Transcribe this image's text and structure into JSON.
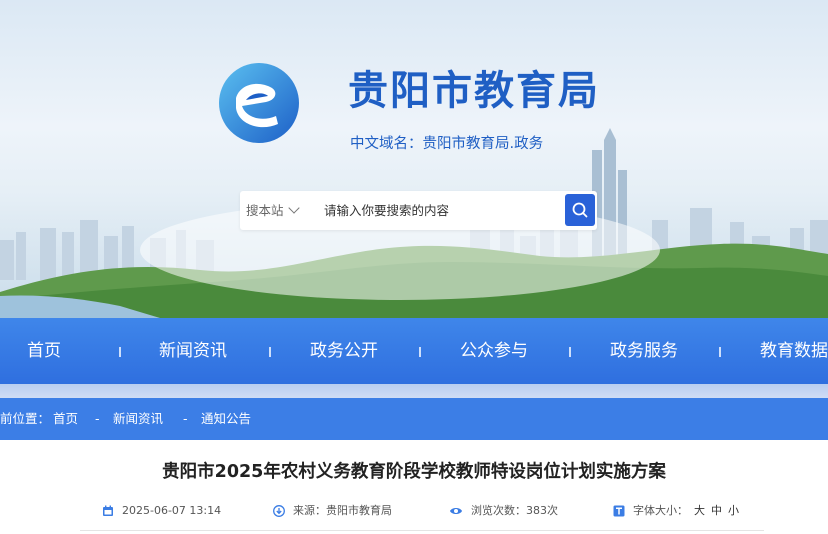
{
  "site": {
    "title": "贵阳市教育局",
    "domain_text": "中文域名：贵阳市教育局.政务"
  },
  "search": {
    "scope_label": "搜本站",
    "placeholder": "请输入你要搜索的内容"
  },
  "nav": {
    "items": [
      "首页",
      "新闻资讯",
      "政务公开",
      "公众参与",
      "政务服务",
      "教育数据"
    ]
  },
  "breadcrumb": {
    "prefix": "前位置：",
    "items": [
      "首页",
      "新闻资讯",
      "通知公告"
    ],
    "separator": "-"
  },
  "article": {
    "title": "贵阳市2025年农村义务教育阶段学校教师特设岗位计划实施方案",
    "date": "2025-06-07 13:14",
    "source": "来源：贵阳市教育局",
    "views": "浏览次数：383次",
    "font_size_label": "字体大小：",
    "font_sizes": [
      "大",
      "中",
      "小"
    ]
  },
  "colors": {
    "brand_blue": "#1f5fc4",
    "nav_blue": "#2f6fdf",
    "crumb_blue": "#3c7ee6"
  }
}
